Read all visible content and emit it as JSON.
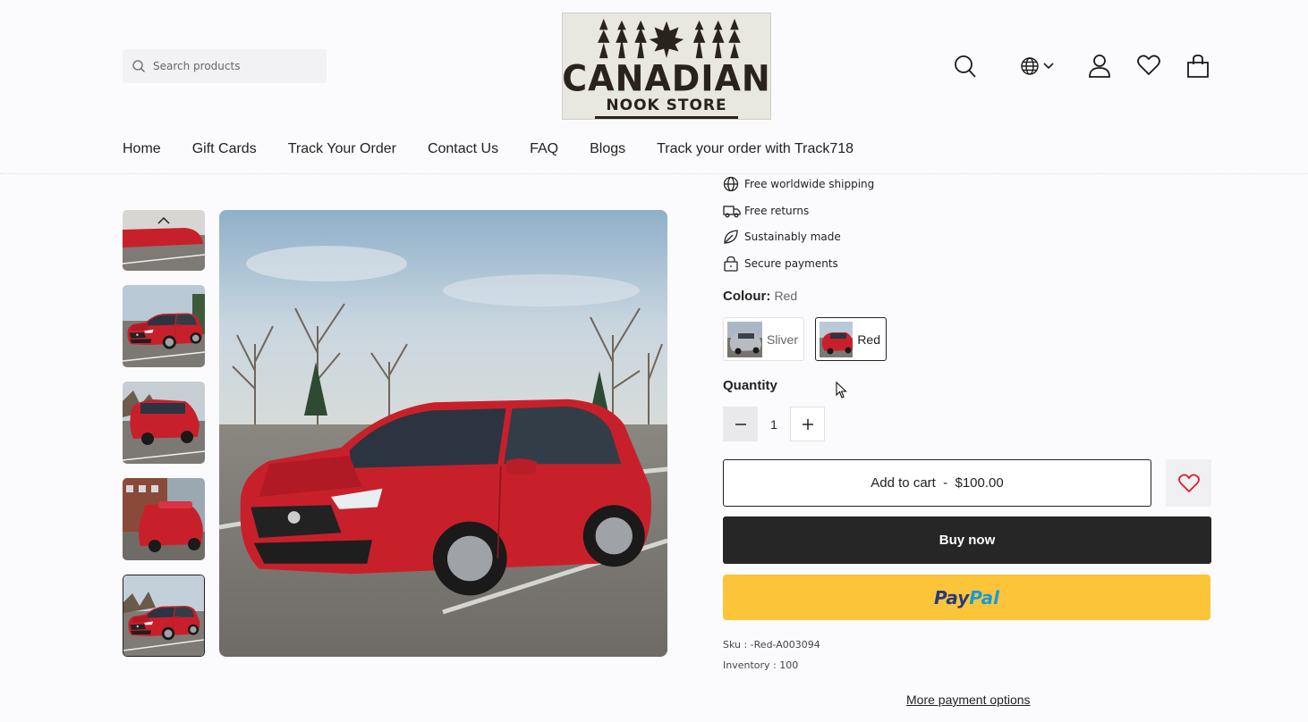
{
  "header": {
    "search": {
      "placeholder": "Search products"
    },
    "logo": {
      "line1": "CANADIAN",
      "line2": "NOOK STORE"
    },
    "icons": [
      "search-icon",
      "globe-icon",
      "user-icon",
      "heart-icon",
      "bag-icon"
    ]
  },
  "nav": {
    "items": [
      {
        "label": "Home"
      },
      {
        "label": "Gift Cards"
      },
      {
        "label": "Track Your Order"
      },
      {
        "label": "Contact Us"
      },
      {
        "label": "FAQ"
      },
      {
        "label": "Blogs"
      },
      {
        "label": "Track your order with Track718"
      }
    ]
  },
  "product": {
    "features": [
      {
        "label": "Free worldwide shipping",
        "icon": "globe-icon"
      },
      {
        "label": "Free returns",
        "icon": "truck-icon"
      },
      {
        "label": "Sustainably made",
        "icon": "leaf-icon"
      },
      {
        "label": "Secure payments",
        "icon": "lock-icon"
      }
    ],
    "colour_label": "Colour:",
    "colour_value": "Red",
    "swatches": [
      {
        "label": "Sliver",
        "selected": false
      },
      {
        "label": "Red",
        "selected": true
      }
    ],
    "quantity_label": "Quantity",
    "quantity_value": "1",
    "add_to_cart": "Add to cart  -  $100.00",
    "buy_now": "Buy now",
    "paypal_a": "Pay",
    "paypal_b": "Pal",
    "sku": "Sku : -Red-A003094",
    "inventory": "Inventory : 100",
    "more_payment": "More payment options"
  },
  "colors": {
    "car_red": "#c8202b",
    "paypal_yellow": "#fcc439",
    "buy_now_bg": "#262626",
    "wish_red": "#d61f26"
  }
}
